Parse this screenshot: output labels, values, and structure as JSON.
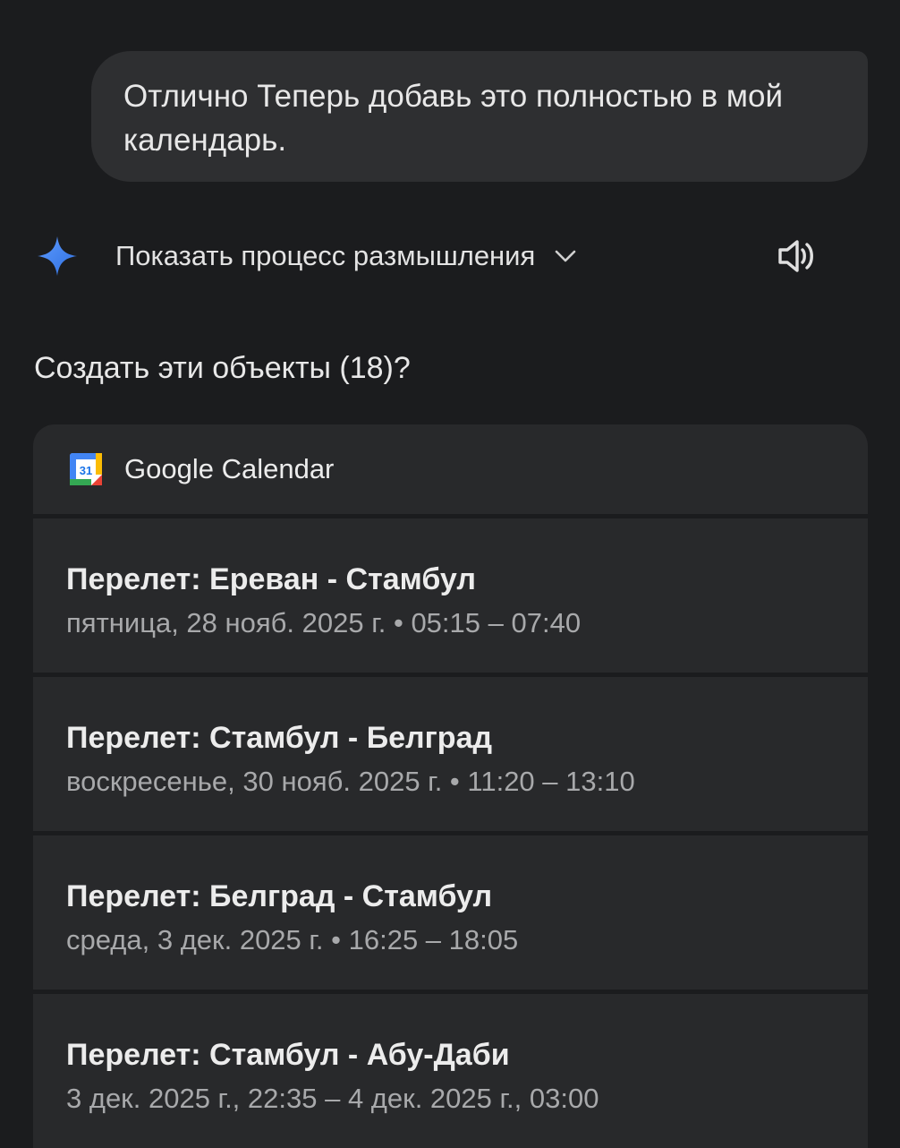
{
  "user_message": {
    "text": "Отлично Теперь добавь это полностью в мой календарь."
  },
  "thinking": {
    "label": "Показать процесс размышления",
    "icons": [
      "spark-icon",
      "chevron-down-icon",
      "speaker-icon"
    ]
  },
  "question": "Создать эти объекты (18)?",
  "calendar": {
    "app_name": "Google Calendar",
    "logo_number": "31",
    "events": [
      {
        "title": "Перелет: Ереван - Стамбул",
        "time": "пятница, 28 нояб. 2025 г. • 05:15 – 07:40"
      },
      {
        "title": "Перелет: Стамбул - Белград",
        "time": "воскресенье, 30 нояб. 2025 г. • 11:20 – 13:10"
      },
      {
        "title": "Перелет: Белград - Стамбул",
        "time": "среда, 3 дек. 2025 г. • 16:25 – 18:05"
      },
      {
        "title": "Перелет: Стамбул - Абу-Даби",
        "time": "3 дек. 2025 г., 22:35 – 4 дек. 2025 г., 03:00"
      }
    ]
  },
  "colors": {
    "background": "#1b1c1e",
    "bubble": "#2e2f31",
    "card": "#28292b",
    "spark_blue": "#4a8cf7"
  }
}
